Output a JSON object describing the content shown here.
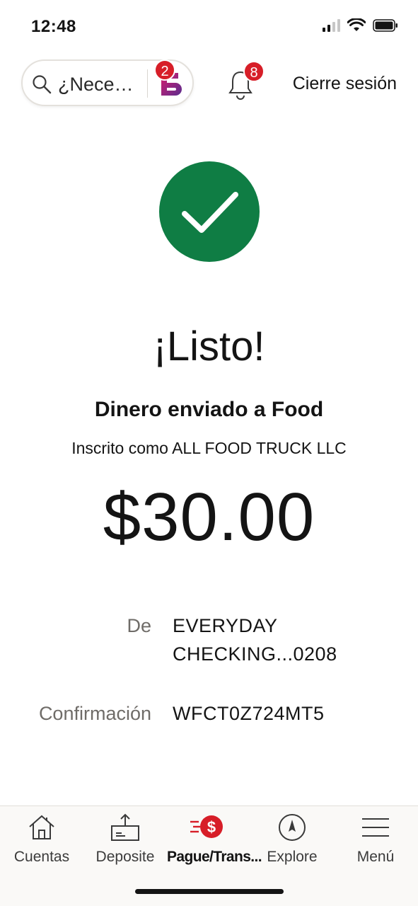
{
  "status_bar": {
    "time": "12:48"
  },
  "header": {
    "search_placeholder": "¿Nece…",
    "assistant_badge": "2",
    "notifications_badge": "8",
    "logout_label": "Cierre sesión"
  },
  "confirmation": {
    "title": "¡Listo!",
    "subtitle": "Dinero enviado a Food",
    "enrolled_as": "Inscrito como ALL FOOD TRUCK LLC",
    "amount": "$30.00",
    "from_label": "De",
    "from_value": "EVERYDAY CHECKING...0208",
    "confirmation_label": "Confirmación",
    "confirmation_value": "WFCT0Z724MT5"
  },
  "tabs": [
    {
      "label": "Cuentas",
      "icon": "home-icon"
    },
    {
      "label": "Deposite",
      "icon": "deposit-icon"
    },
    {
      "label": "Pague/Trans...",
      "icon": "pay-transfer-icon",
      "active": true
    },
    {
      "label": "Explore",
      "icon": "compass-icon"
    },
    {
      "label": "Menú",
      "icon": "hamburger-menu-icon"
    }
  ],
  "colors": {
    "success_green": "#0f7d44",
    "badge_red": "#d71e28",
    "assistant_purple": "#6b2c91",
    "tab_bar_bg": "#faf9f7"
  }
}
